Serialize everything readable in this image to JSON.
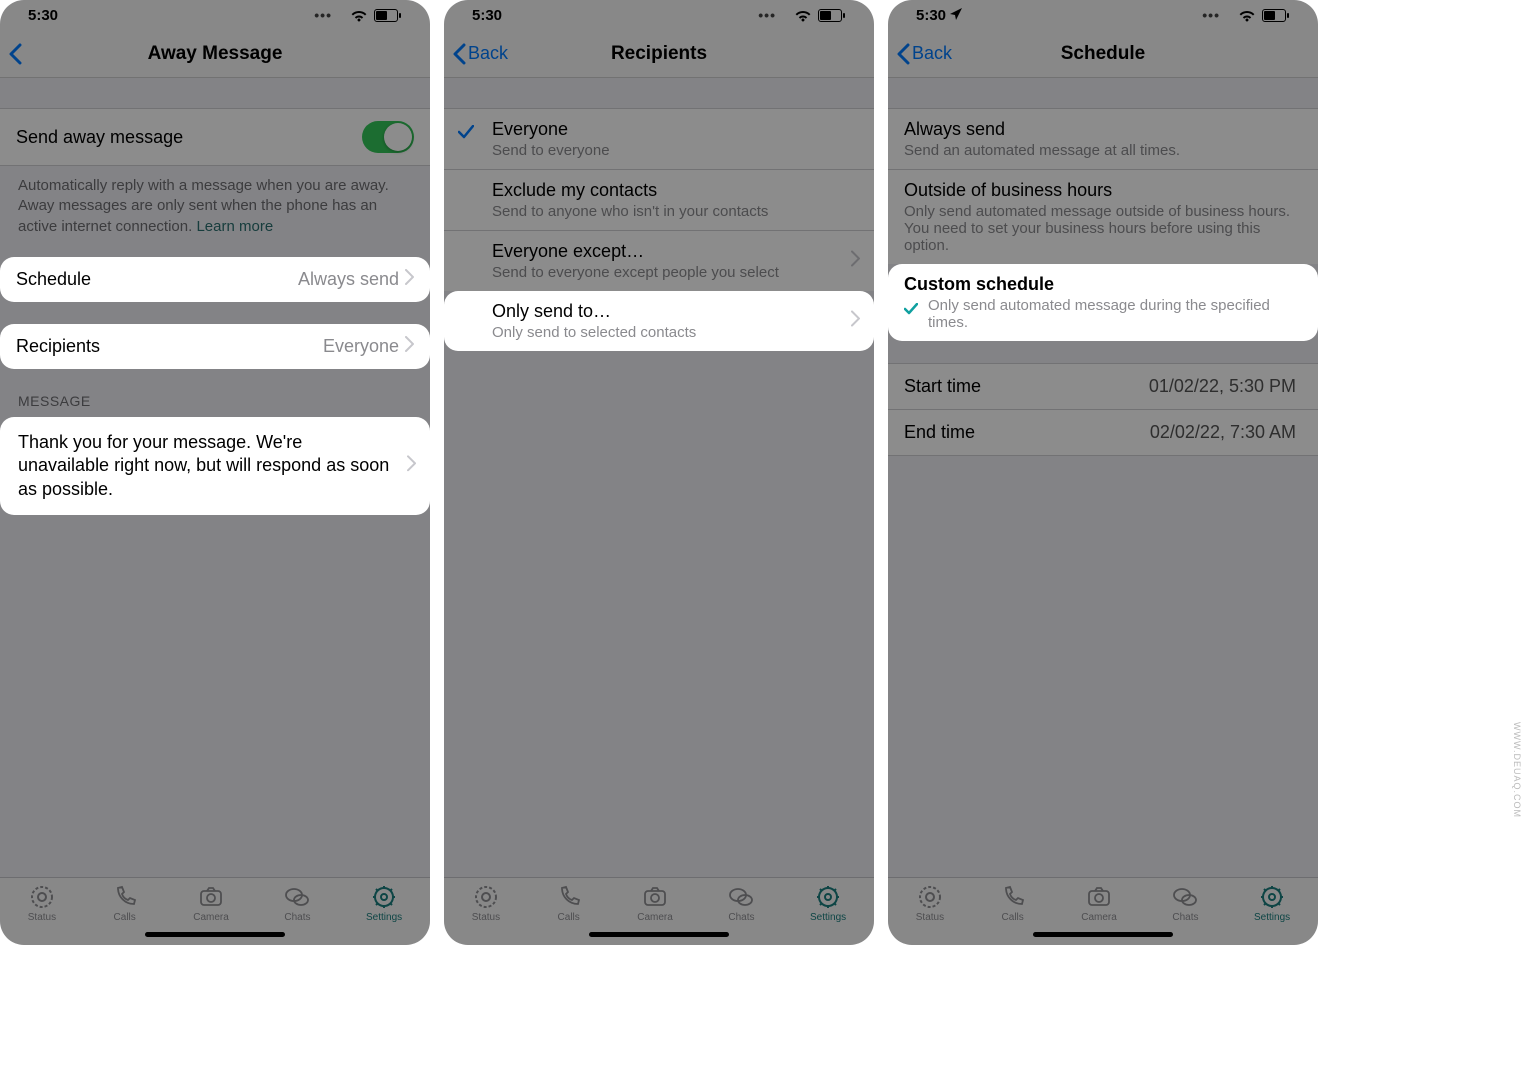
{
  "statusbar": {
    "time": "5:30"
  },
  "screens": [
    {
      "nav": {
        "back": "",
        "title": "Away Message"
      },
      "toggleRow": {
        "label": "Send away message"
      },
      "note": "Automatically reply with a message when you are away. Away messages are only sent when the phone has an active internet connection.",
      "noteLink": "Learn more",
      "scheduleRow": {
        "label": "Schedule",
        "value": "Always send"
      },
      "recipientsRow": {
        "label": "Recipients",
        "value": "Everyone"
      },
      "messageHeader": "MESSAGE",
      "messageBody": "Thank you for your message. We're unavailable right now, but will respond as soon as possible."
    },
    {
      "nav": {
        "back": "Back",
        "title": "Recipients"
      },
      "options": [
        {
          "title": "Everyone",
          "sub": "Send to everyone",
          "checked": true
        },
        {
          "title": "Exclude my contacts",
          "sub": "Send to anyone who isn't in your contacts"
        },
        {
          "title": "Everyone except…",
          "sub": "Send to everyone except people you select",
          "chev": true
        },
        {
          "title": "Only send to…",
          "sub": "Only send to selected contacts",
          "chev": true
        }
      ]
    },
    {
      "nav": {
        "back": "Back",
        "title": "Schedule"
      },
      "options": [
        {
          "title": "Always send",
          "sub": "Send an automated message at all times."
        },
        {
          "title": "Outside of business hours",
          "sub": "Only send automated message outside of business hours. You need to set your business hours before using this option."
        },
        {
          "title": "Custom schedule",
          "sub": "Only send automated message during the specified times.",
          "checked": true
        }
      ],
      "timeRows": [
        {
          "label": "Start time",
          "value": "01/02/22, 5:30 PM"
        },
        {
          "label": "End time",
          "value": "02/02/22, 7:30 AM"
        }
      ]
    }
  ],
  "tabs": [
    {
      "label": "Status"
    },
    {
      "label": "Calls"
    },
    {
      "label": "Camera"
    },
    {
      "label": "Chats"
    },
    {
      "label": "Settings"
    }
  ],
  "watermark": "WWW.DEUAQ.COM"
}
